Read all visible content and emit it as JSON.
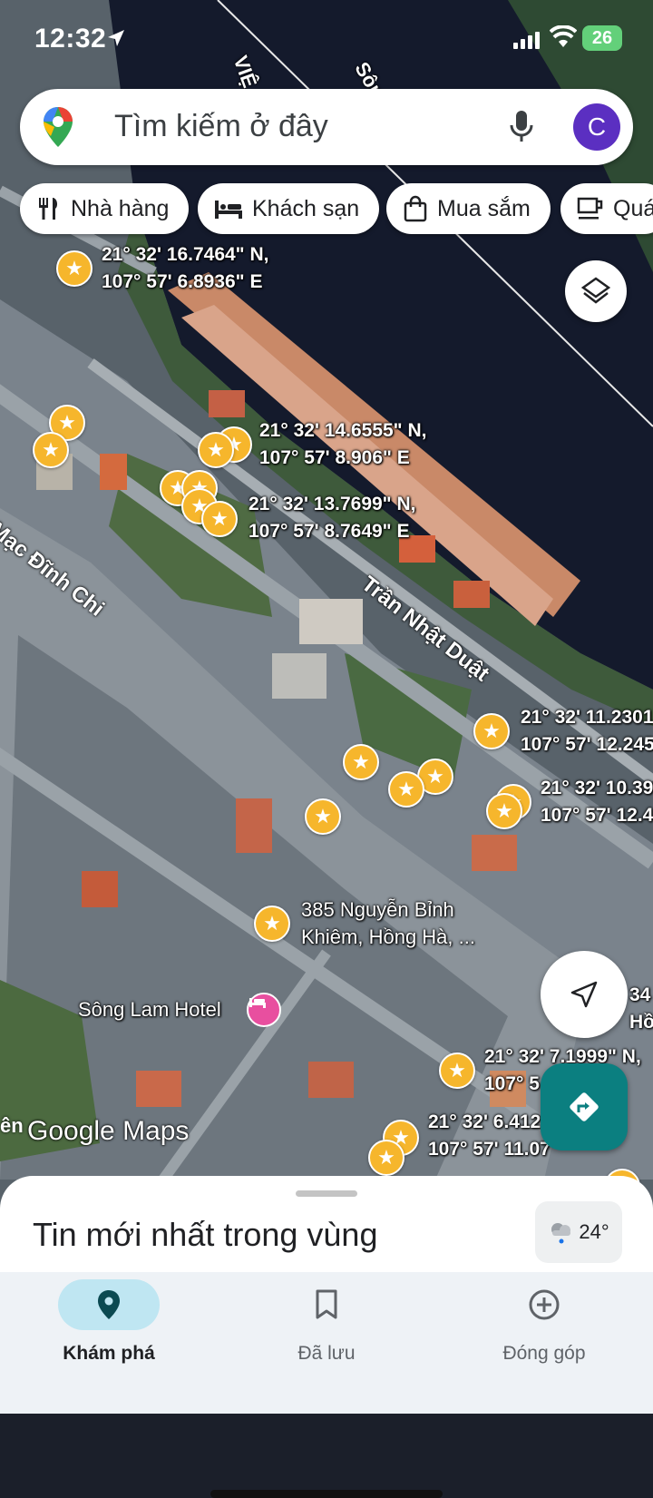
{
  "status_bar": {
    "time": "12:32",
    "battery": "26"
  },
  "search": {
    "placeholder": "Tìm kiếm ở đây",
    "avatar_letter": "C"
  },
  "chips": [
    {
      "label": "Nhà hàng",
      "icon": "fork-knife-icon"
    },
    {
      "label": "Khách sạn",
      "icon": "bed-icon"
    },
    {
      "label": "Mua sắm",
      "icon": "shopping-bag-icon"
    },
    {
      "label": "Quán",
      "icon": "coffee-cup-icon"
    }
  ],
  "map": {
    "labels": [
      {
        "text": "21° 32' 16.7464\" N,\n107° 57' 6.8936\" E"
      },
      {
        "text": "21° 32' 14.6555\" N,\n107° 57' 8.906\" E"
      },
      {
        "text": "21° 32' 13.7699\" N,\n107° 57' 8.7649\" E"
      },
      {
        "text": "21° 32' 11.2301\n107° 57' 12.245"
      },
      {
        "text": "21° 32' 10.39\n107° 57' 12.4"
      },
      {
        "text": "385 Nguyễn Bỉnh\nKhiêm, Hồng Hà, ..."
      },
      {
        "text": "21° 32' 7.1999\" N,\n107° 5"
      },
      {
        "text": "21° 32' 6.412\n107° 57' 11.07"
      },
      {
        "text": "34\nHồ"
      }
    ],
    "streets": [
      "Mạc Đĩnh Chi",
      "Trần Nhật Duật",
      "Sông"
    ],
    "river_text": "VIỆ",
    "hotel": "Sông Lam Hotel",
    "brand": "Google Maps",
    "cutoff_left": "ên"
  },
  "sheet": {
    "title": "Tin mới nhất trong vùng",
    "temperature": "24°"
  },
  "tabs": [
    {
      "label": "Khám phá",
      "icon": "location-pin-icon",
      "active": true
    },
    {
      "label": "Đã lưu",
      "icon": "bookmark-icon",
      "active": false
    },
    {
      "label": "Đóng góp",
      "icon": "plus-circle-icon",
      "active": false
    }
  ],
  "colors": {
    "accent": "#0b7f80",
    "pin": "#f6b62c",
    "avatar": "#5b2fc1",
    "active_tab": "#bfe6f2"
  }
}
